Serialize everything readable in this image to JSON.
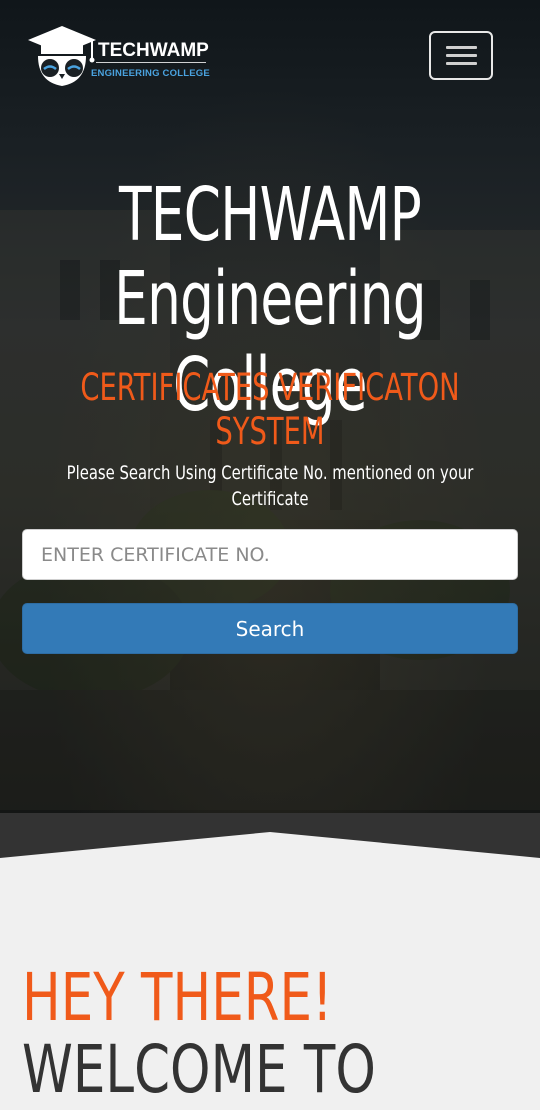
{
  "navbar": {
    "logo_title": "TECHWAMP",
    "logo_subtitle": "ENGINEERING COLLEGE",
    "menu_icon": "hamburger-menu-icon"
  },
  "hero": {
    "title_line1": "TECHWAMP",
    "title_line2": "Engineering College",
    "subtitle": "CERTIFICATES VERIFICATON SYSTEM",
    "instruction": "Please Search Using Certificate No. mentioned on your Certificate",
    "search": {
      "placeholder": "ENTER CERTIFICATE NO.",
      "value": "",
      "button_label": "Search"
    }
  },
  "section": {
    "heading": "HEY THERE!",
    "subheading": "WELCOME TO"
  },
  "colors": {
    "accent": "#f05a1a",
    "button": "#337ab7",
    "logo_sub": "#4aa3e0"
  }
}
